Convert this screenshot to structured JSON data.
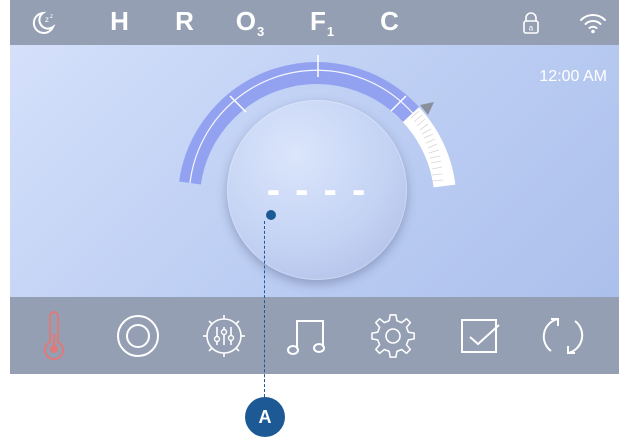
{
  "status_bar": {
    "sleep_icon": "sleep-moon-icon",
    "modes": [
      {
        "letter": "H",
        "sub": ""
      },
      {
        "letter": "R",
        "sub": ""
      },
      {
        "letter": "O",
        "sub": "3"
      },
      {
        "letter": "F",
        "sub": "1"
      },
      {
        "letter": "C",
        "sub": ""
      }
    ],
    "lock_icon": "lock-icon",
    "wifi_icon": "wifi-icon"
  },
  "clock": "12:00 AM",
  "dial": {
    "readout": "- - - -",
    "icon_arc": "temperature-dial-icon",
    "arrow_icon": "arrow-icon"
  },
  "toolbar": {
    "items": [
      {
        "name": "temperature",
        "icon": "thermometer-icon"
      },
      {
        "name": "jets",
        "icon": "rings-icon"
      },
      {
        "name": "settings",
        "icon": "sliders-icon"
      },
      {
        "name": "audio",
        "icon": "music-icon"
      },
      {
        "name": "setup",
        "icon": "gear-icon"
      },
      {
        "name": "checklist",
        "icon": "checkbox-icon"
      },
      {
        "name": "refresh",
        "icon": "refresh-icon"
      }
    ]
  },
  "callout": {
    "label": "A"
  },
  "colors": {
    "bar": "#949fb3",
    "arc_active": "#8f9ff0",
    "knob": "#c4d3f4",
    "callout": "#1d5a95",
    "thermometer": "#e07a7a"
  }
}
